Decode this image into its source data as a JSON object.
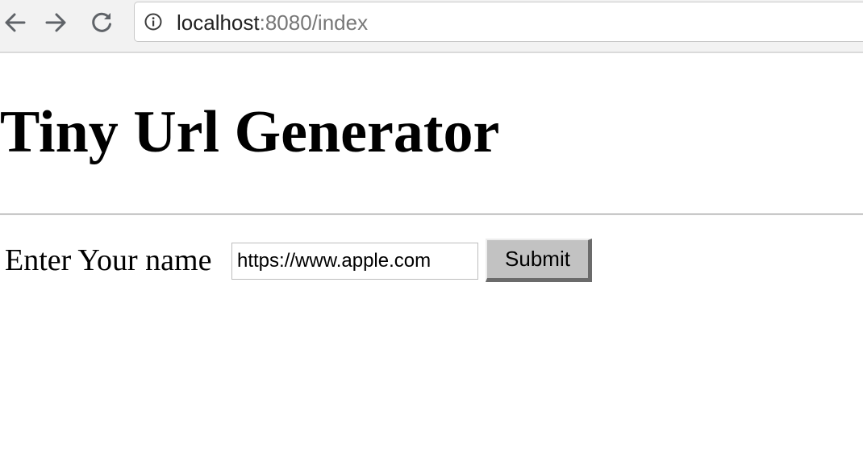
{
  "browser": {
    "url_host": "localhost",
    "url_rest": ":8080/index",
    "icons": {
      "back": "arrow-left-icon",
      "forward": "arrow-right-icon",
      "reload": "reload-icon",
      "site_info": "info-icon"
    }
  },
  "page": {
    "title": "Tiny Url Generator",
    "form": {
      "label": "Enter Your name",
      "input_value": "https://www.apple.com",
      "submit_label": "Submit"
    }
  }
}
